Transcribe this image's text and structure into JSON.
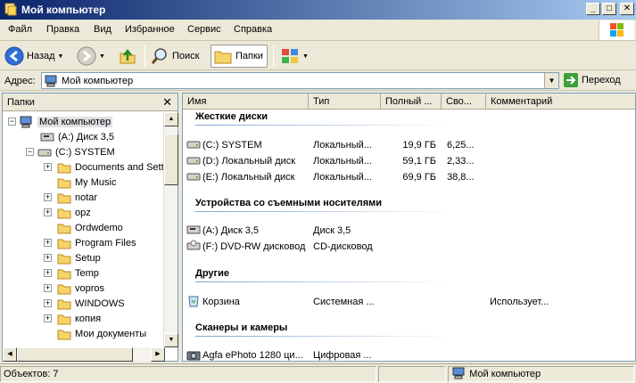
{
  "window": {
    "title": "Мой компьютер"
  },
  "menu": [
    "Файл",
    "Правка",
    "Вид",
    "Избранное",
    "Сервис",
    "Справка"
  ],
  "toolbar": {
    "back": "Назад",
    "search": "Поиск",
    "folders": "Папки"
  },
  "address": {
    "label": "Адрес:",
    "value": "Мой компьютер",
    "go": "Переход"
  },
  "folders_pane": {
    "title": "Папки",
    "tree": [
      {
        "label": "Мой компьютер",
        "expander": "−",
        "indent": 0
      },
      {
        "label": "(A:) Диск 3,5",
        "expander": "",
        "indent": 1
      },
      {
        "label": "(C:) SYSTEM",
        "expander": "−",
        "indent": 1
      },
      {
        "label": "Documents and Setti",
        "expander": "+",
        "indent": 2
      },
      {
        "label": "My Music",
        "expander": "",
        "indent": 2
      },
      {
        "label": "notar",
        "expander": "+",
        "indent": 2
      },
      {
        "label": "opz",
        "expander": "+",
        "indent": 2
      },
      {
        "label": "Ordwdemo",
        "expander": "",
        "indent": 2
      },
      {
        "label": "Program Files",
        "expander": "+",
        "indent": 2
      },
      {
        "label": "Setup",
        "expander": "+",
        "indent": 2
      },
      {
        "label": "Temp",
        "expander": "+",
        "indent": 2
      },
      {
        "label": "vopros",
        "expander": "+",
        "indent": 2
      },
      {
        "label": "WINDOWS",
        "expander": "+",
        "indent": 2
      },
      {
        "label": "копия",
        "expander": "+",
        "indent": 2
      },
      {
        "label": "Мои документы",
        "expander": "",
        "indent": 2
      }
    ]
  },
  "columns": [
    "Имя",
    "Тип",
    "Полный ...",
    "Сво...",
    "Комментарий"
  ],
  "groups": [
    {
      "title": "Жесткие диски",
      "items": [
        {
          "name": "(C:) SYSTEM",
          "type": "Локальный...",
          "total": "19,9 ГБ",
          "free": "6,25...",
          "comment": "",
          "icon": "hard-drive-icon"
        },
        {
          "name": "(D:) Локальный диск",
          "type": "Локальный...",
          "total": "59,1 ГБ",
          "free": "2,33...",
          "comment": "",
          "icon": "hard-drive-icon"
        },
        {
          "name": "(E:) Локальный диск",
          "type": "Локальный...",
          "total": "69,9 ГБ",
          "free": "38,8...",
          "comment": "",
          "icon": "hard-drive-icon"
        }
      ]
    },
    {
      "title": "Устройства со съемными носителями",
      "items": [
        {
          "name": "(A:) Диск 3,5",
          "type": "Диск 3,5",
          "total": "",
          "free": "",
          "comment": "",
          "icon": "floppy-drive-icon"
        },
        {
          "name": "(F:) DVD-RW дисковод",
          "type": "CD-дисковод",
          "total": "",
          "free": "",
          "comment": "",
          "icon": "dvd-drive-icon"
        }
      ]
    },
    {
      "title": "Другие",
      "items": [
        {
          "name": "Корзина",
          "type": "Системная ...",
          "total": "",
          "free": "",
          "comment": "Использует...",
          "icon": "recycle-bin-icon"
        }
      ]
    },
    {
      "title": "Сканеры и камеры",
      "items": [
        {
          "name": "Agfa ePhoto 1280 ци...",
          "type": "Цифровая ...",
          "total": "",
          "free": "",
          "comment": "",
          "icon": "camera-icon"
        }
      ]
    }
  ],
  "status": {
    "objects": "Объектов: 7",
    "location": "Мой компьютер"
  },
  "colors": {
    "titlebar_start": "#0a246a",
    "titlebar_end": "#a6caf0",
    "chrome": "#ece9d8",
    "border": "#7f9db9",
    "group_title": "#000000"
  }
}
